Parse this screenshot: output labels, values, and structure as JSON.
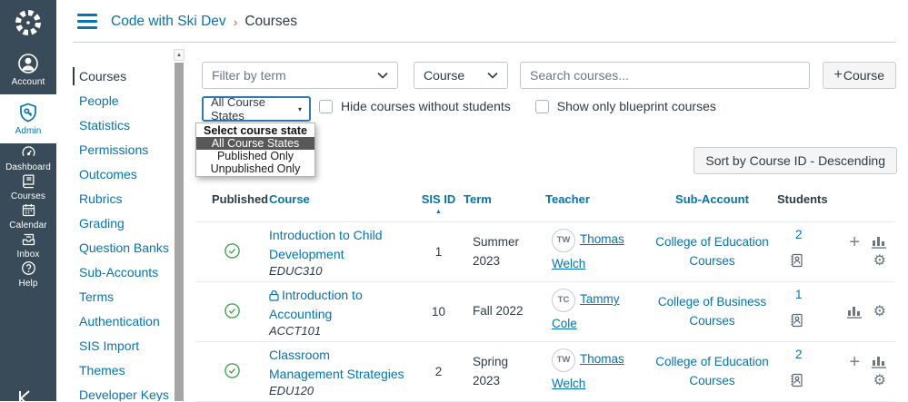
{
  "colors": {
    "nav_bg": "#394B58",
    "link": "#0374B5",
    "text": "#2D3B45",
    "success": "#44A350",
    "focus_ring": "#2B7ABC"
  },
  "global_nav": {
    "items": [
      {
        "label": "Account"
      },
      {
        "label": "Admin"
      },
      {
        "label": "Dashboard"
      },
      {
        "label": "Courses"
      },
      {
        "label": "Calendar"
      },
      {
        "label": "Inbox"
      },
      {
        "label": "Help"
      }
    ]
  },
  "breadcrumb": {
    "account": "Code with Ski Dev",
    "separator": "›",
    "page": "Courses"
  },
  "sidebar": {
    "items": [
      {
        "label": "Courses"
      },
      {
        "label": "People"
      },
      {
        "label": "Statistics"
      },
      {
        "label": "Permissions"
      },
      {
        "label": "Outcomes"
      },
      {
        "label": "Rubrics"
      },
      {
        "label": "Grading"
      },
      {
        "label": "Question Banks"
      },
      {
        "label": "Sub-Accounts"
      },
      {
        "label": "Terms"
      },
      {
        "label": "Authentication"
      },
      {
        "label": "SIS Import"
      },
      {
        "label": "Themes"
      },
      {
        "label": "Developer Keys"
      }
    ]
  },
  "filters": {
    "term_placeholder": "Filter by term",
    "type_value": "Course",
    "search_placeholder": "Search courses...",
    "add_plus": "+",
    "add_label": "Course",
    "states_value": "All Course States",
    "states_arrow": "▾",
    "hide_checkbox_label": "Hide courses without students",
    "blueprint_checkbox_label": "Show only blueprint courses",
    "states_menu": {
      "header": "Select course state",
      "options": [
        {
          "label": "All Course States"
        },
        {
          "label": "Published Only"
        },
        {
          "label": "Unpublished Only"
        }
      ],
      "selected": "All Course States"
    },
    "sort_button": "Sort by Course ID - Descending"
  },
  "table": {
    "headers": [
      {
        "label": "Published"
      },
      {
        "label": "Course"
      },
      {
        "label": "SIS ID"
      },
      {
        "label": "Term"
      },
      {
        "label": "Teacher"
      },
      {
        "label": "Sub-Account"
      },
      {
        "label": "Students"
      }
    ],
    "sort_indicator": "▲",
    "rows": [
      {
        "published": "published",
        "title": "Introduction to Child Development",
        "code": "EDUC310",
        "sis_id": "1",
        "term": "Summer 2023",
        "teacher_initials": "TW",
        "teacher_name": "Thomas Welch",
        "sub_account": "College of Education Courses",
        "students": "2"
      },
      {
        "published": "published",
        "title": "Introduction to Accounting",
        "code": "ACCT101",
        "sis_id": "10",
        "term": "Fall 2022",
        "teacher_initials": "TC",
        "teacher_name": "Tammy Cole",
        "sub_account": "College of Business Courses",
        "students": "1"
      },
      {
        "published": "published",
        "title": "Classroom Management Strategies",
        "code": "EDU120",
        "sis_id": "2",
        "term": "Spring 2023",
        "teacher_initials": "TW",
        "teacher_name": "Thomas Welch",
        "sub_account": "College of Education Courses",
        "students": "2"
      }
    ]
  }
}
